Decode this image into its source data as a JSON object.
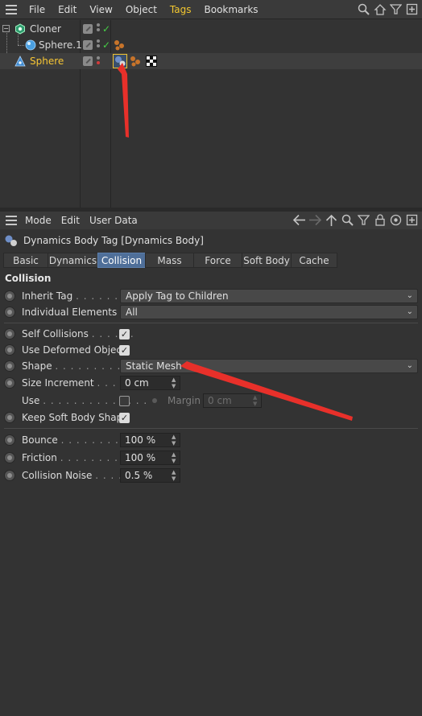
{
  "object_manager": {
    "menu": [
      "File",
      "Edit",
      "View",
      "Object",
      "Tags",
      "Bookmarks"
    ],
    "objects": [
      {
        "name": "Cloner"
      },
      {
        "name": "Sphere.1"
      },
      {
        "name": "Sphere"
      }
    ]
  },
  "attribute_manager": {
    "menu": [
      "Mode",
      "Edit",
      "User Data"
    ],
    "title": "Dynamics Body Tag [Dynamics Body]",
    "tabs": [
      "Basic",
      "Dynamics",
      "Collision",
      "Mass",
      "Force",
      "Soft Body",
      "Cache"
    ],
    "active_tab": "Collision",
    "section": "Collision",
    "params": {
      "inherit_tag": {
        "label": "Inherit Tag",
        "dots": ". . . . . . . .",
        "value": "Apply Tag to Children"
      },
      "individual_elements": {
        "label": "Individual Elements",
        "value": "All"
      },
      "self_collisions": {
        "label": "Self Collisions",
        "dots": ". . . . . .",
        "checked": true
      },
      "use_deformed_object": {
        "label": "Use Deformed Object",
        "checked": true
      },
      "shape": {
        "label": "Shape",
        "dots": ". . . . . . . . . . . .",
        "value": "Static Mesh"
      },
      "size_increment": {
        "label": "Size Increment",
        "dots": ". . . . .",
        "value": "0 cm"
      },
      "use": {
        "label": "Use",
        "dots": ". . . . . . . . . . . . . .",
        "checked": false
      },
      "margin": {
        "label": "Margin",
        "value": "0 cm"
      },
      "keep_soft_body_shape": {
        "label": "Keep Soft Body Shape",
        "checked": true
      },
      "bounce": {
        "label": "Bounce",
        "dots": ". . . . . . . . . .",
        "value": "100 %"
      },
      "friction": {
        "label": "Friction",
        "dots": ". . . . . . . . . .",
        "value": "100 %"
      },
      "collision_noise": {
        "label": "Collision Noise",
        "dots": ". . . . .",
        "value": "0.5 %"
      }
    }
  },
  "colors": {
    "active_tag_menu": "#f3c72f",
    "active_tab": "#4f6f99",
    "annotation_arrow": "#e8302a",
    "check": "#46d046"
  }
}
